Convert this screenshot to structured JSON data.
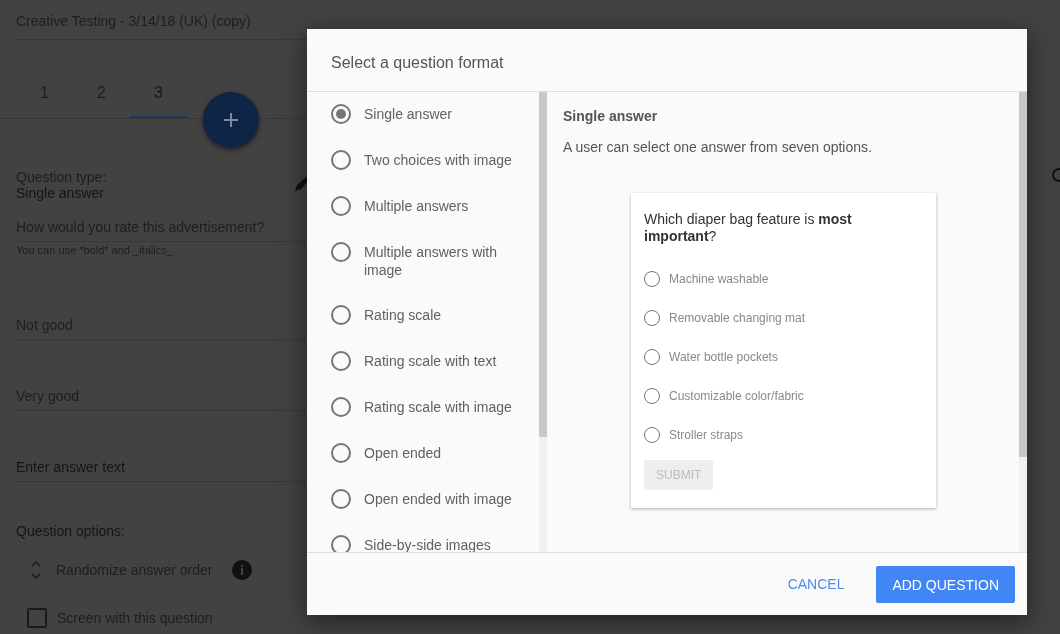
{
  "page": {
    "survey_name": "Creative Testing - 3/14/18 (UK) (copy)",
    "tabs": [
      {
        "label": "1",
        "selected": false
      },
      {
        "label": "2",
        "selected": false
      },
      {
        "label": "3",
        "selected": true
      }
    ],
    "question_type_label": "Question type:",
    "question_type": "Single answer",
    "question_text": "How would you rate this advertisement?",
    "hint": "You can use *bold* and _italics_",
    "answers": [
      {
        "value": "Not good"
      },
      {
        "value": "Very good"
      },
      {
        "placeholder": "Enter answer text"
      }
    ],
    "options_heading": "Question options:",
    "randomize": "Randomize answer order",
    "screen": {
      "label": "Screen with this question",
      "checked": false
    }
  },
  "dialog": {
    "title": "Select a question format",
    "formats": [
      {
        "label": "Single answer",
        "selected": true
      },
      {
        "label": "Two choices with image",
        "selected": false
      },
      {
        "label": "Multiple answers",
        "selected": false
      },
      {
        "label": "Multiple answers with image",
        "selected": false
      },
      {
        "label": "Rating scale",
        "selected": false
      },
      {
        "label": "Rating scale with text",
        "selected": false
      },
      {
        "label": "Rating scale with image",
        "selected": false
      },
      {
        "label": "Open ended",
        "selected": false
      },
      {
        "label": "Open ended with image",
        "selected": false
      },
      {
        "label": "Side-by-side images",
        "selected": false
      }
    ],
    "preview": {
      "heading": "Single answer",
      "description": "A user can select one answer from seven options.",
      "question": "Which diaper bag feature is **most important**?",
      "options": [
        {
          "label": "Machine washable",
          "selected": false
        },
        {
          "label": "Removable changing mat",
          "selected": false
        },
        {
          "label": "Water bottle pockets",
          "selected": false
        },
        {
          "label": "Customizable color/fabric",
          "selected": false
        },
        {
          "label": "Stroller straps",
          "selected": false
        }
      ],
      "submit": "SUBMIT"
    },
    "cancel": "CANCEL",
    "confirm": "ADD QUESTION"
  }
}
